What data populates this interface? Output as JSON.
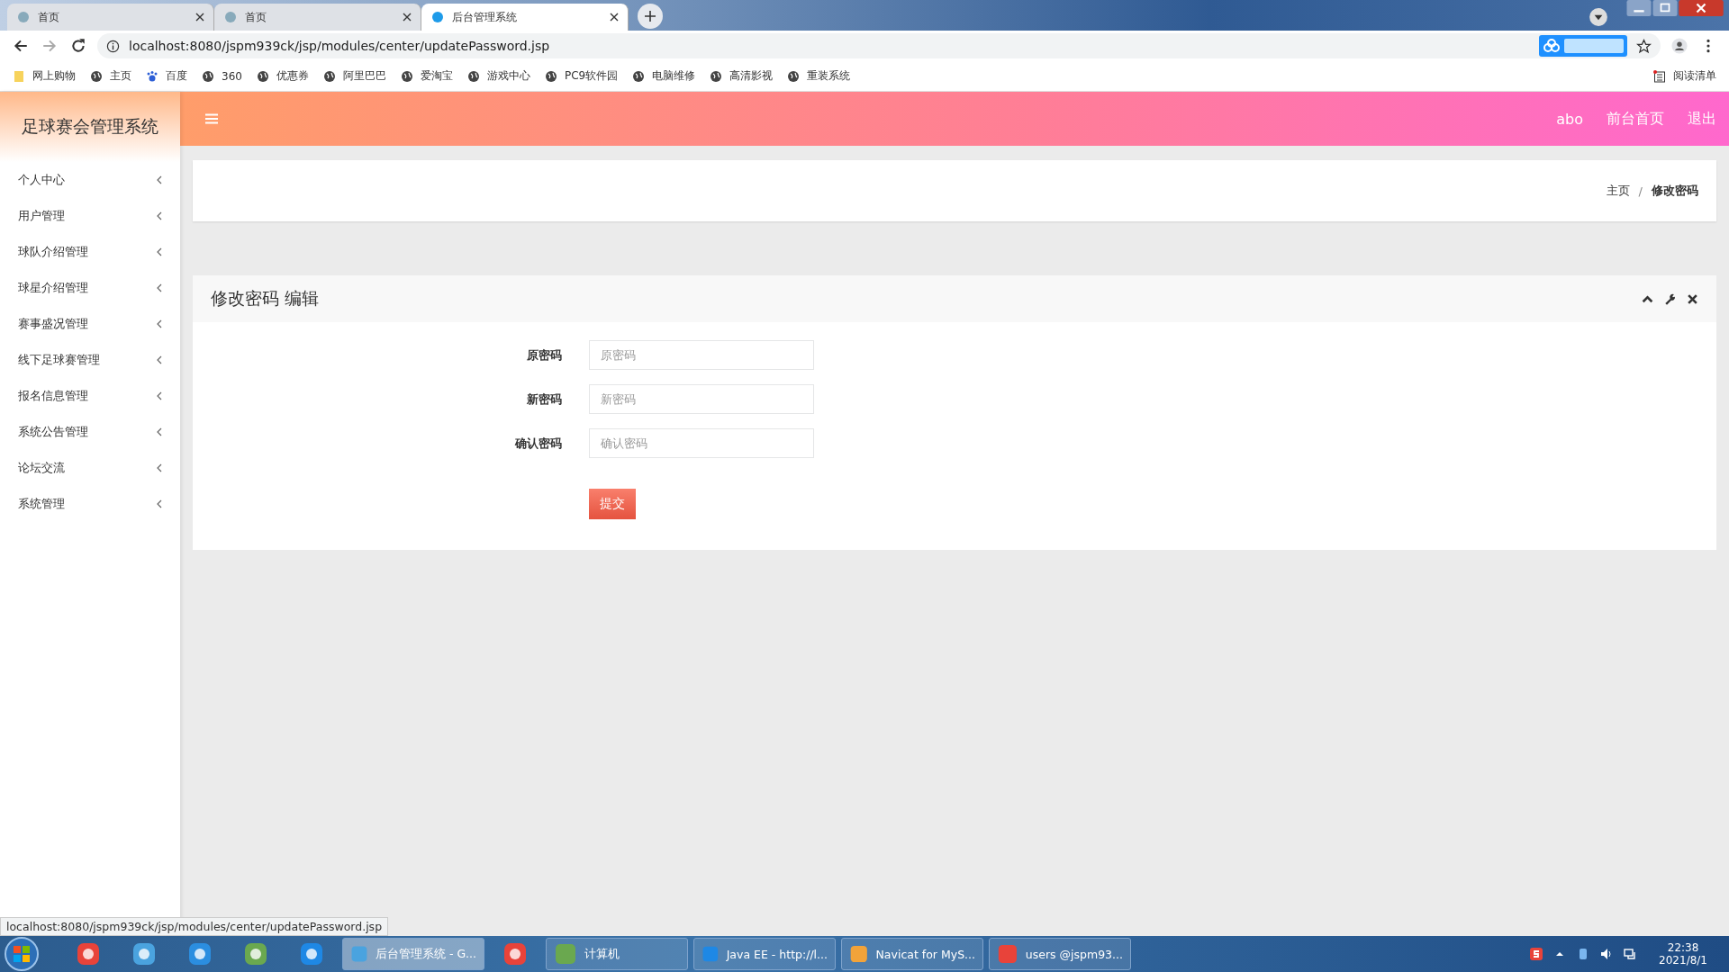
{
  "browser": {
    "tabs": [
      {
        "title": "首页",
        "selected": false
      },
      {
        "title": "首页",
        "selected": false
      },
      {
        "title": "后台管理系统",
        "selected": true
      }
    ],
    "address": "localhost:8080/jspm939ck/jsp/modules/center/updatePassword.jsp",
    "bookmarks": [
      {
        "label": "网上购物",
        "kind": "folder"
      },
      {
        "label": "主页",
        "kind": "globe"
      },
      {
        "label": "百度",
        "kind": "paw"
      },
      {
        "label": "360",
        "kind": "globe"
      },
      {
        "label": "优惠券",
        "kind": "globe"
      },
      {
        "label": "阿里巴巴",
        "kind": "globe"
      },
      {
        "label": "爱淘宝",
        "kind": "globe"
      },
      {
        "label": "游戏中心",
        "kind": "globe"
      },
      {
        "label": "PC9软件园",
        "kind": "globe"
      },
      {
        "label": "电脑维修",
        "kind": "globe"
      },
      {
        "label": "高清影视",
        "kind": "globe"
      },
      {
        "label": "重装系统",
        "kind": "globe"
      }
    ],
    "reading_list": "阅读清单"
  },
  "app": {
    "title": "足球赛会管理系统",
    "header_links": [
      "abo",
      "前台首页",
      "退出"
    ],
    "sidebar": {
      "items": [
        {
          "label": "个人中心"
        },
        {
          "label": "用户管理"
        },
        {
          "label": "球队介绍管理"
        },
        {
          "label": "球星介绍管理"
        },
        {
          "label": "赛事盛况管理"
        },
        {
          "label": "线下足球赛管理"
        },
        {
          "label": "报名信息管理"
        },
        {
          "label": "系统公告管理"
        },
        {
          "label": "论坛交流"
        },
        {
          "label": "系统管理"
        }
      ]
    },
    "breadcrumb_separator": "/",
    "breadcrumb": [
      {
        "label": "主页",
        "current": false
      },
      {
        "label": "修改密码",
        "current": true
      }
    ],
    "panel": {
      "title": "修改密码 编辑",
      "fields": [
        {
          "label": "原密码",
          "placeholder": "原密码"
        },
        {
          "label": "新密码",
          "placeholder": "新密码"
        },
        {
          "label": "确认密码",
          "placeholder": "确认密码"
        }
      ],
      "submit": "提交"
    }
  },
  "status_url": "localhost:8080/jspm939ck/jsp/modules/center/updatePassword.jsp",
  "taskbar": {
    "items": [
      {
        "kind": "pin"
      },
      {
        "kind": "pin"
      },
      {
        "kind": "pin"
      },
      {
        "kind": "pin"
      },
      {
        "kind": "pin"
      },
      {
        "kind": "window",
        "label": "后台管理系统 - G...",
        "selected": true
      },
      {
        "kind": "pin"
      },
      {
        "kind": "window",
        "label": "计算机",
        "selected": false
      },
      {
        "kind": "window",
        "label": "Java EE - http://l...",
        "selected": false
      },
      {
        "kind": "window",
        "label": "Navicat for MyS...",
        "selected": false
      },
      {
        "kind": "window",
        "label": "users @jspm93...",
        "selected": false
      }
    ],
    "time": "22:38",
    "date": "2021/8/1"
  }
}
